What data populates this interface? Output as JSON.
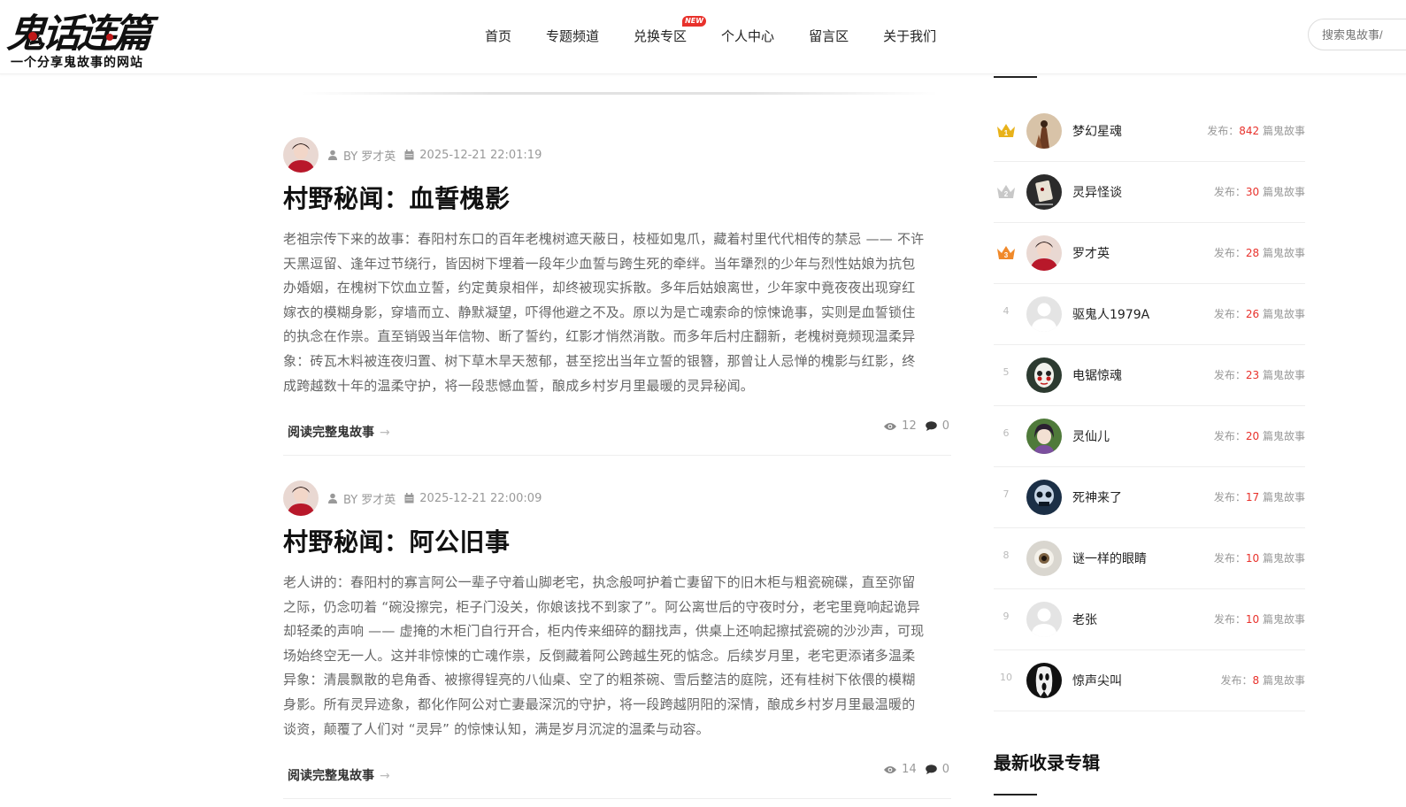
{
  "header": {
    "logo_title": "鬼话连篇",
    "logo_subtitle": "一个分享鬼故事的网站",
    "nav": [
      {
        "label": "首页"
      },
      {
        "label": "专题频道"
      },
      {
        "label": "兑换专区",
        "badge": "NEW"
      },
      {
        "label": "个人中心"
      },
      {
        "label": "留言区"
      },
      {
        "label": "关于我们"
      }
    ],
    "search_placeholder": "搜索鬼故事/"
  },
  "articles": [
    {
      "author": "BY 罗才英",
      "date": "2025-12-21 22:01:19",
      "title": "村野秘闻：血誓槐影",
      "excerpt_lines": [
        "老祖宗传下来的故事：春阳村东口的百年老槐树遮天蔽日，枝桠如鬼爪，藏着村里代代相传的禁忌 —— 不许",
        "天黑逗留、逢年过节绕行，皆因树下埋着一段年少血誓与跨生死的牵绊。当年犟烈的少年与烈性姑娘为抗包",
        "办婚姻，在槐树下饮血立誓，约定黄泉相伴，却终被现实拆散。多年后姑娘离世，少年家中竟夜夜出现穿红",
        "嫁衣的模糊身影，穿墙而立、静默凝望，吓得他避之不及。原以为是亡魂索命的惊悚诡事，实则是血誓锁住",
        "的执念在作祟。直至销毁当年信物、断了誓约，红影才悄然消散。而多年后村庄翻新，老槐树竟频现温柔异",
        "象：砖瓦木料被连夜归置、树下草木旱天葱郁，甚至挖出当年立誓的银簪，那曾让人忌惮的槐影与红影，终",
        "成跨越数十年的温柔守护，将一段悲憾血誓，酿成乡村岁月里最暖的灵异秘闻。"
      ],
      "read_more": "阅读完整鬼故事",
      "arrow": "→",
      "views": "12",
      "comments": "0"
    },
    {
      "author": "BY 罗才英",
      "date": "2025-12-21 22:00:09",
      "title": "村野秘闻：阿公旧事",
      "excerpt_lines": [
        "老人讲的：春阳村的寡言阿公一辈子守着山脚老宅，执念般呵护着亡妻留下的旧木柜与粗瓷碗碟，直至弥留",
        "之际，仍念叨着 “碗没擦完，柜子门没关，你娘该找不到家了”。阿公离世后的守夜时分，老宅里竟响起诡异",
        "却轻柔的声响 —— 虚掩的木柜门自行开合，柜内传来细碎的翻找声，供桌上还响起擦拭瓷碗的沙沙声，可现",
        "场始终空无一人。这并非惊悚的亡魂作祟，反倒藏着阿公跨越生死的惦念。后续岁月里，老宅更添诸多温柔",
        "异象：清晨飘散的皂角香、被擦得锃亮的八仙桌、空了的粗茶碗、雪后整洁的庭院，还有桂树下依偎的模糊",
        "身影。所有灵异迹象，都化作阿公对亡妻最深沉的守护，将一段跨越阴阳的深情，酿成乡村岁月里最温暖的",
        "谈资，颠覆了人们对 “灵异” 的惊悚认知，满是岁月沉淀的温柔与动容。"
      ],
      "read_more": "阅读完整鬼故事",
      "arrow": "→",
      "views": "14",
      "comments": "0"
    }
  ],
  "sidebar": {
    "ranking": [
      {
        "rank": "1",
        "name": "梦幻星魂",
        "prefix": "发布：",
        "count": "842",
        "suffix": " 篇鬼故事",
        "crown_color": "#e8b21a"
      },
      {
        "rank": "2",
        "name": "灵异怪谈",
        "prefix": "发布：",
        "count": "30",
        "suffix": " 篇鬼故事",
        "crown_color": "#c8c8c8"
      },
      {
        "rank": "3",
        "name": "罗才英",
        "prefix": "发布：",
        "count": "28",
        "suffix": " 篇鬼故事",
        "crown_color": "#f0892a"
      },
      {
        "rank": "4",
        "name": "驱鬼人1979A",
        "prefix": "发布：",
        "count": "26",
        "suffix": " 篇鬼故事"
      },
      {
        "rank": "5",
        "name": "电锯惊魂",
        "prefix": "发布：",
        "count": "23",
        "suffix": " 篇鬼故事"
      },
      {
        "rank": "6",
        "name": "灵仙儿",
        "prefix": "发布：",
        "count": "20",
        "suffix": " 篇鬼故事"
      },
      {
        "rank": "7",
        "name": "死神来了",
        "prefix": "发布：",
        "count": "17",
        "suffix": " 篇鬼故事"
      },
      {
        "rank": "8",
        "name": "谜一样的眼睛",
        "prefix": "发布：",
        "count": "10",
        "suffix": " 篇鬼故事"
      },
      {
        "rank": "9",
        "name": "老张",
        "prefix": "发布：",
        "count": "10",
        "suffix": " 篇鬼故事"
      },
      {
        "rank": "10",
        "name": "惊声尖叫",
        "prefix": "发布：",
        "count": "8",
        "suffix": " 篇鬼故事"
      }
    ],
    "section_title": "最新收录专辑"
  },
  "colors": {
    "accent_red": "#e8312b",
    "crown_gold": "#e8b21a",
    "crown_silver": "#c8c8c8",
    "crown_bronze": "#f0892a"
  }
}
